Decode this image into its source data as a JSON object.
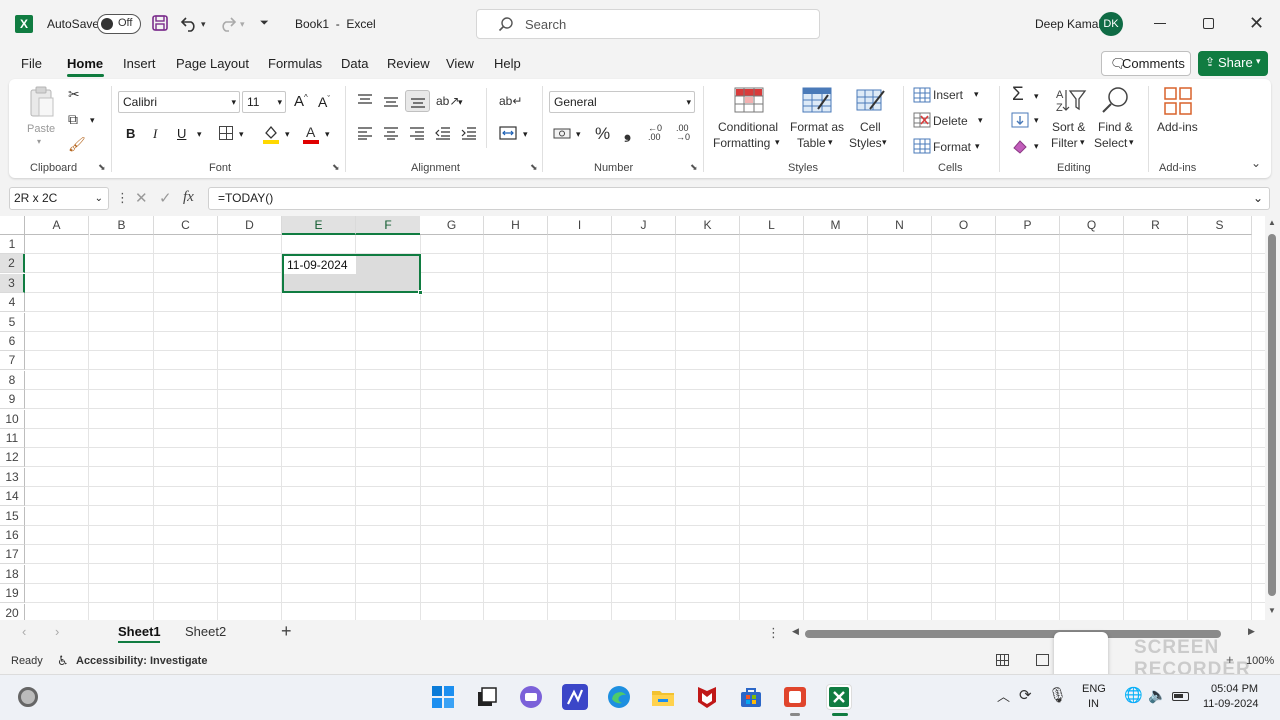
{
  "titlebar": {
    "autosave_label": "AutoSave",
    "autosave_state": "Off",
    "doc_title": "Book1  -  Excel",
    "search_placeholder": "Search",
    "user_name": "Deep Kamal",
    "user_initials": "DK"
  },
  "menu": {
    "items": [
      "File",
      "Home",
      "Insert",
      "Page Layout",
      "Formulas",
      "Data",
      "Review",
      "View",
      "Help"
    ],
    "active": "Home",
    "comments_label": "Comments",
    "share_label": "Share"
  },
  "ribbon": {
    "clipboard": {
      "paste_label": "Paste",
      "group_label": "Clipboard"
    },
    "font": {
      "font_name": "Calibri",
      "font_size": "11",
      "group_label": "Font",
      "bold": "B",
      "italic": "I",
      "underline": "U"
    },
    "alignment": {
      "group_label": "Alignment"
    },
    "number": {
      "format": "General",
      "group_label": "Number",
      "percent": "%",
      "comma": "❟"
    },
    "styles": {
      "conditional_l1": "Conditional",
      "conditional_l2": "Formatting",
      "format_table_l1": "Format as",
      "format_table_l2": "Table",
      "cell_styles_l1": "Cell",
      "cell_styles_l2": "Styles",
      "group_label": "Styles"
    },
    "cells": {
      "insert_label": "Insert",
      "delete_label": "Delete",
      "format_label": "Format",
      "group_label": "Cells"
    },
    "editing": {
      "sort_l1": "Sort &",
      "sort_l2": "Filter",
      "find_l1": "Find &",
      "find_l2": "Select",
      "group_label": "Editing"
    },
    "addins": {
      "label": "Add-ins",
      "group_label": "Add-ins"
    }
  },
  "formula_bar": {
    "name_box": "2R x 2C",
    "fx": "fx",
    "formula": "=TODAY()"
  },
  "grid": {
    "columns": [
      "A",
      "B",
      "C",
      "D",
      "E",
      "F",
      "G",
      "H",
      "I",
      "J",
      "K",
      "L",
      "M",
      "N",
      "O",
      "P",
      "Q",
      "R",
      "S"
    ],
    "rows": [
      "1",
      "2",
      "3",
      "4",
      "5",
      "6",
      "7",
      "8",
      "9",
      "10",
      "11",
      "12",
      "13",
      "14",
      "15",
      "16",
      "17",
      "18",
      "19",
      "20"
    ],
    "selected_columns": [
      "E",
      "F"
    ],
    "selected_rows": [
      "2",
      "3"
    ],
    "cell_E2": "11-09-2024"
  },
  "sheets": {
    "tabs": [
      "Sheet1",
      "Sheet2"
    ],
    "active": "Sheet1",
    "add": "+"
  },
  "status": {
    "ready": "Ready",
    "accessibility": "Accessibility: Investigate",
    "zoom": "100%",
    "watermark_l1": "SCREEN",
    "watermark_l2": "RECORDER"
  },
  "taskbar": {
    "lang_l1": "ENG",
    "lang_l2": "IN",
    "time": "05:04 PM",
    "date": "11-09-2024"
  },
  "colors": {
    "excel_green": "#107c41",
    "accent_dark": "#0f7b3e",
    "selection_fill": "#dcdcdc"
  }
}
